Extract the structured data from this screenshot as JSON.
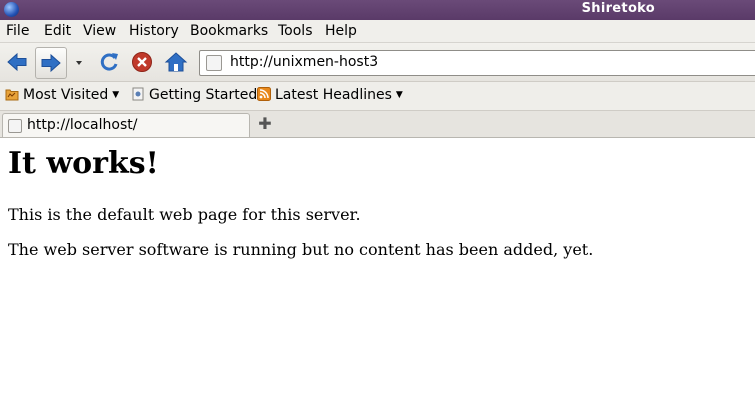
{
  "window": {
    "title": "Shiretoko"
  },
  "menu": [
    "File",
    "Edit",
    "View",
    "History",
    "Bookmarks",
    "Tools",
    "Help"
  ],
  "nav": {
    "url": "http://unixmen-host3",
    "icons": [
      "back-arrow-icon",
      "forward-arrow-icon",
      "history-dropdown-icon",
      "reload-icon",
      "stop-icon",
      "home-icon"
    ]
  },
  "bookmarks": [
    {
      "label": "Most Visited",
      "icon": "bookmark-folder-icon",
      "dropdown": true
    },
    {
      "label": "Getting Started",
      "icon": "page-icon",
      "dropdown": false
    },
    {
      "label": "Latest Headlines",
      "icon": "rss-feed-icon",
      "dropdown": true
    }
  ],
  "tabs": [
    {
      "label": "http://localhost/"
    }
  ],
  "page": {
    "heading": "It works!",
    "paragraphs": [
      "This is the default web page for this server.",
      "The web server software is running but no content has been added, yet."
    ]
  },
  "colors": {
    "titlebar": "#5f4070",
    "nav_blue": "#2f6fc4",
    "stop_red": "#c0392b",
    "rss_orange": "#e8891c"
  }
}
